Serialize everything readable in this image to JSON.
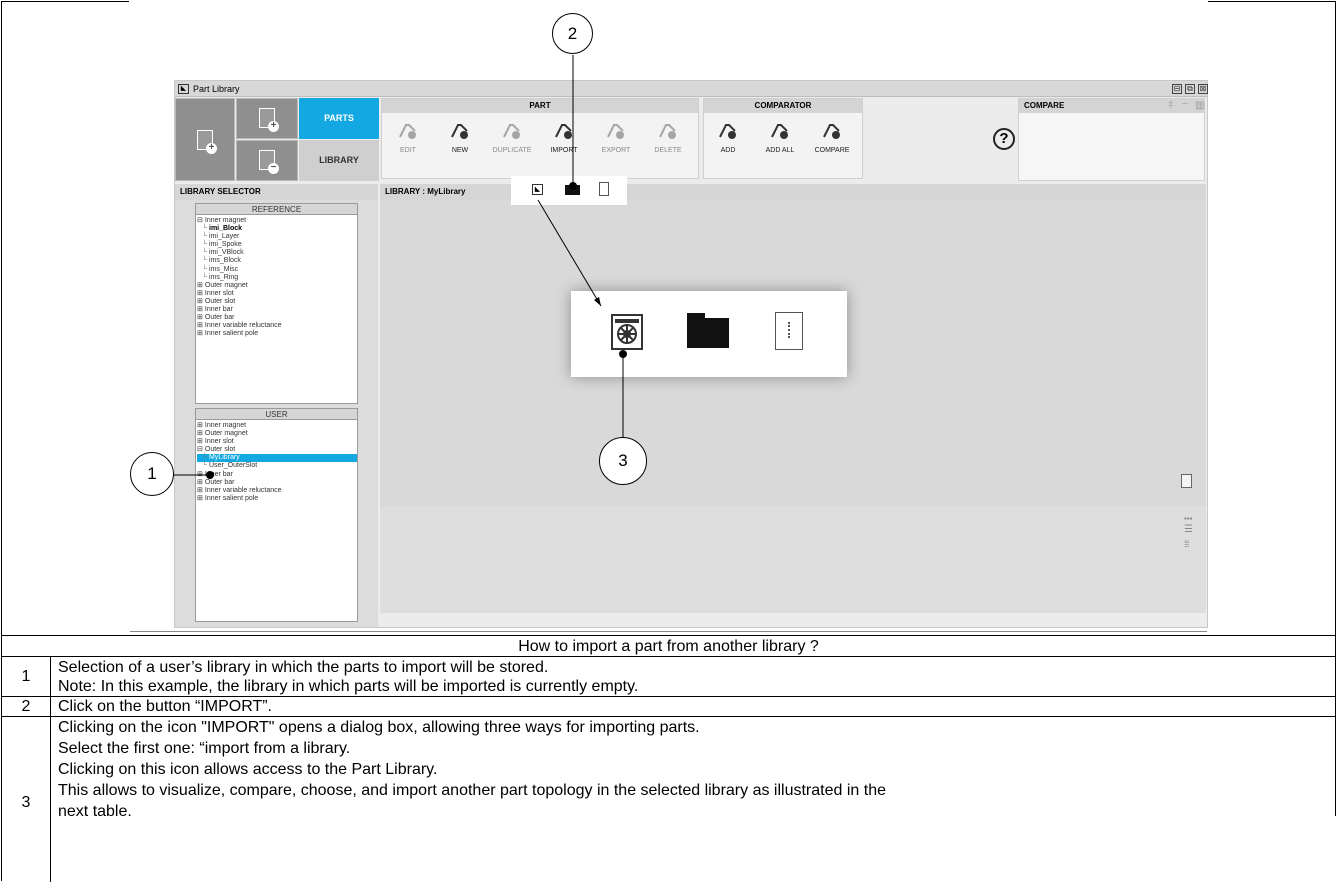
{
  "window": {
    "title": "Part Library",
    "controls": [
      "⊟",
      "⧉",
      "⊠"
    ]
  },
  "tabs": {
    "parts": "PARTS",
    "library": "LIBRARY"
  },
  "part_group": {
    "title": "PART",
    "tools": [
      {
        "label": "EDIT",
        "icon": "edit-part-icon",
        "active": false
      },
      {
        "label": "NEW",
        "icon": "new-part-icon",
        "active": true
      },
      {
        "label": "DUPLICATE",
        "icon": "duplicate-part-icon",
        "active": false
      },
      {
        "label": "IMPORT",
        "icon": "import-part-icon",
        "active": true
      },
      {
        "label": "EXPORT",
        "icon": "export-part-icon",
        "active": false
      },
      {
        "label": "DELETE",
        "icon": "delete-part-icon",
        "active": false
      }
    ]
  },
  "comparator_group": {
    "title": "COMPARATOR",
    "tools": [
      {
        "label": "ADD",
        "icon": "compare-add-icon"
      },
      {
        "label": "ADD ALL",
        "icon": "compare-add-all-icon"
      },
      {
        "label": "COMPARE",
        "icon": "compare-icon"
      }
    ]
  },
  "help_glyph": "?",
  "compare_panel": {
    "title": "COMPARE"
  },
  "library_selector": {
    "title": "LIBRARY SELECTOR",
    "reference": {
      "title": "REFERENCE",
      "items": [
        {
          "label": "Inner magnet",
          "type": "parent",
          "prefix": "⊟"
        },
        {
          "label": "imi_Block",
          "type": "child-bold"
        },
        {
          "label": "imi_Layer",
          "type": "child"
        },
        {
          "label": "imi_Spoke",
          "type": "child"
        },
        {
          "label": "imi_VBlock",
          "type": "child"
        },
        {
          "label": "ims_Block",
          "type": "child"
        },
        {
          "label": "ims_Misc",
          "type": "child"
        },
        {
          "label": "ims_Ring",
          "type": "child"
        },
        {
          "label": "Outer magnet",
          "type": "parent",
          "prefix": "⊞"
        },
        {
          "label": "Inner slot",
          "type": "parent",
          "prefix": "⊞"
        },
        {
          "label": "Outer slot",
          "type": "parent",
          "prefix": "⊞"
        },
        {
          "label": "Inner bar",
          "type": "parent",
          "prefix": "⊞"
        },
        {
          "label": "Outer bar",
          "type": "parent",
          "prefix": "⊞"
        },
        {
          "label": "Inner variable reluctance",
          "type": "parent",
          "prefix": "⊞"
        },
        {
          "label": "Inner salient pole",
          "type": "parent",
          "prefix": "⊞"
        }
      ]
    },
    "user": {
      "title": "USER",
      "items": [
        {
          "label": "Inner magnet",
          "type": "parent",
          "prefix": "⊞"
        },
        {
          "label": "Outer magnet",
          "type": "parent",
          "prefix": "⊞"
        },
        {
          "label": "Inner slot",
          "type": "parent",
          "prefix": "⊞"
        },
        {
          "label": "Outer slot",
          "type": "parent",
          "prefix": "⊟"
        },
        {
          "label": "MyLibrary",
          "type": "child-selected"
        },
        {
          "label": "User_OuterSlot",
          "type": "child"
        },
        {
          "label": "Inner bar",
          "type": "parent",
          "prefix": "⊞"
        },
        {
          "label": "Outer bar",
          "type": "parent",
          "prefix": "⊞"
        },
        {
          "label": "Inner variable reluctance",
          "type": "parent",
          "prefix": "⊞"
        },
        {
          "label": "Inner salient pole",
          "type": "parent",
          "prefix": "⊞"
        }
      ]
    }
  },
  "library_panel": {
    "title": "LIBRARY : MyLibrary"
  },
  "callouts": [
    "1",
    "2",
    "3"
  ],
  "table": {
    "header": "How to import a part from another library ?",
    "rows": [
      {
        "num": "1",
        "lines": [
          "Selection of a user’s library in which the parts to import will be stored.",
          "Note: In this example, the library in which parts will be imported is currently empty."
        ]
      },
      {
        "num": "2",
        "lines": [
          "Click on the button “IMPORT”."
        ]
      },
      {
        "num": "3",
        "lines": [
          "Clicking on the icon \"IMPORT\" opens a dialog box, allowing three ways for importing parts.",
          "Select the first one: “import from a library.",
          "Clicking on this icon allows access to the Part Library.",
          "This allows to visualize, compare, choose, and import another part topology in the selected library as illustrated in the",
          "next table."
        ]
      }
    ]
  },
  "colors": {
    "accent": "#13a8e1",
    "tile": "#8f8f8f",
    "panel_bg": "#d9d9d9"
  }
}
